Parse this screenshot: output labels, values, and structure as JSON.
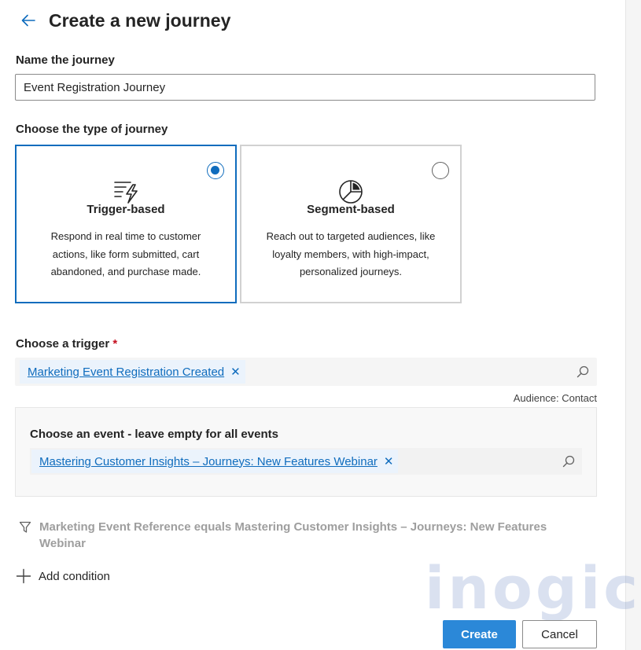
{
  "header": {
    "title": "Create a new journey",
    "back_icon": "arrow-left-icon"
  },
  "name_section": {
    "label": "Name the journey",
    "value": "Event Registration Journey"
  },
  "type_section": {
    "label": "Choose the type of journey",
    "options": [
      {
        "title": "Trigger-based",
        "description": "Respond in real time to customer actions, like form submitted, cart abandoned, and purchase made.",
        "selected": true,
        "icon": "trigger-lightning-icon"
      },
      {
        "title": "Segment-based",
        "description": "Reach out to targeted audiences, like loyalty members, with high-impact, personalized journeys.",
        "selected": false,
        "icon": "segment-pie-icon"
      }
    ]
  },
  "trigger_section": {
    "label": "Choose a trigger",
    "required_mark": "*",
    "selected_trigger": "Marketing Event Registration Created",
    "remove_glyph": "✕",
    "audience": "Audience: Contact"
  },
  "event_section": {
    "label": "Choose an event - leave empty for all events",
    "selected_event": "Mastering Customer Insights – Journeys: New Features Webinar",
    "remove_glyph": "✕"
  },
  "condition": {
    "text": "Marketing Event Reference equals Mastering Customer Insights – Journeys: New Features Webinar",
    "icon": "filter-icon"
  },
  "add_condition": {
    "label": "Add condition",
    "icon": "plus-icon"
  },
  "watermark": {
    "text": "inogic"
  },
  "footer": {
    "create_label": "Create",
    "cancel_label": "Cancel"
  },
  "colors": {
    "accent": "#0f6cbd",
    "primary_button": "#2b88d8",
    "tag_bg": "#ebf3fc",
    "field_bg": "#f5f5f5",
    "muted_text": "#9e9e9e"
  }
}
